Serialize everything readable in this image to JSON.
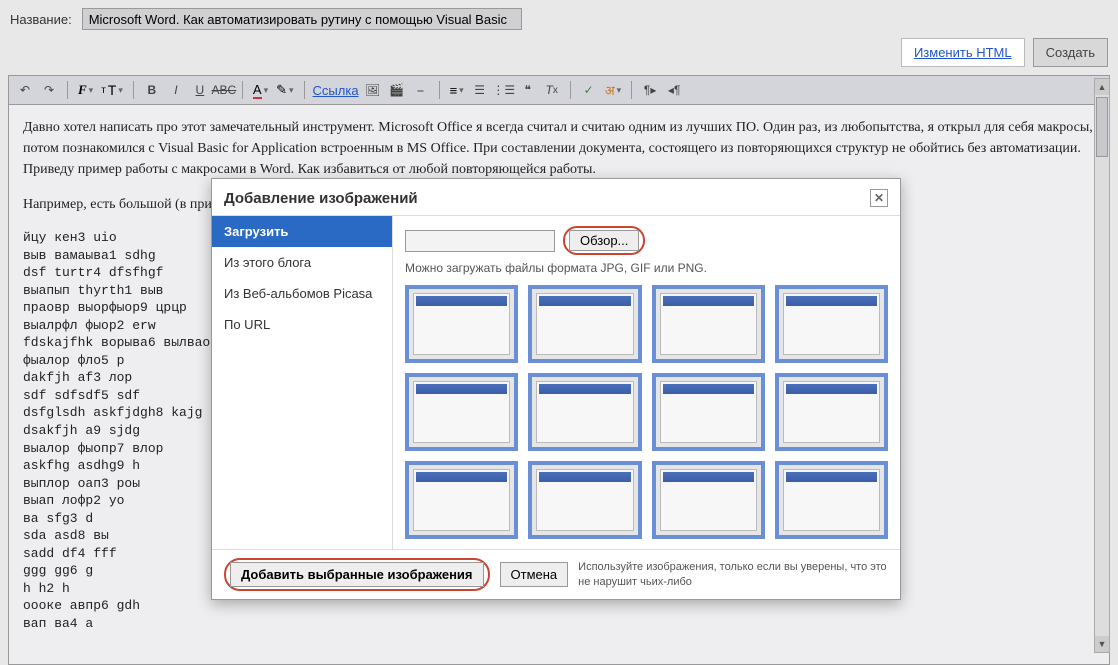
{
  "header": {
    "label": "Название:",
    "title_value": "Microsoft Word. Как автоматизировать рутину с помощью Visual Basic"
  },
  "actions": {
    "edit_html": "Изменить HTML",
    "create": "Создать"
  },
  "toolbar": {
    "link_label": "Ссылка"
  },
  "editor": {
    "p1": "Давно хотел написать про этот замечательный инструмент. Microsoft Office я всегда считал и считаю одним из лучших ПО. Один раз, из любопытства, я открыл для себя макросы, потом познакомился с Visual Basic for Application встроенным в MS Office. При составлении документа, состоящего из повторяющихся структур не обойтись без автоматизации. Приведу пример работы с макросами в Word. Как избавиться от любой повторяющейся работы.",
    "p2": "Например, есть большой (в примере маленький, суть не меняется) текст:",
    "mono": "йцу кен3 uio\nвыв вамаыва1 sdhg\ndsf turtr4 dfsfhgf\nвыапып thyrth1 выв\nпраовр выорфыор9 црцр\nвыалрфл фыор2 erw\nfdskajfhk ворыва6 вылвао\nфыалор фло5 p\ndakfjh af3 лор\nsdf sdfsdf5 sdf\ndsfglsdh askfjdgh8 kajg\ndsakfjh a9 sjdg\nвыалор фыопр7 влор\naskfhg asdhg9 h\nвыплор оап3 роы\nвыап лофр2 yo\nва sfg3 d\nsda asd8 вы\nsadd df4 fff\nggg gg6 g\nh h2 h\nоооке авпр6 gdh\nвап ва4 а"
  },
  "dialog": {
    "title": "Добавление изображений",
    "tabs": {
      "upload": "Загрузить",
      "from_blog": "Из этого блога",
      "picasa": "Из Веб-альбомов Picasa",
      "by_url": "По URL"
    },
    "browse": "Обзор...",
    "hint": "Можно загружать файлы формата JPG, GIF или PNG.",
    "add": "Добавить выбранные изображения",
    "cancel": "Отмена",
    "note": "Используйте изображения, только если вы уверены, что это не нарушит чьих-либо"
  }
}
